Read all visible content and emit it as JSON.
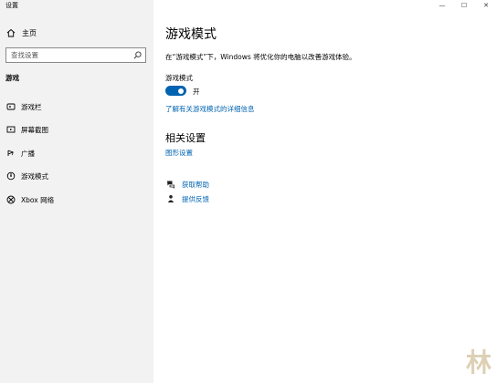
{
  "window": {
    "title": "设置",
    "controls": [
      "—",
      "☐",
      "✕"
    ]
  },
  "sidebar": {
    "home_label": "主页",
    "search_placeholder": "查找设置",
    "section_label": "游戏",
    "items": [
      {
        "label": "游戏栏",
        "icon": "game-bar-icon"
      },
      {
        "label": "屏幕截图",
        "icon": "capture-icon"
      },
      {
        "label": "广播",
        "icon": "broadcast-icon"
      },
      {
        "label": "游戏模式",
        "icon": "game-mode-icon"
      },
      {
        "label": "Xbox 网络",
        "icon": "xbox-icon"
      }
    ]
  },
  "main": {
    "title": "游戏模式",
    "description": "在“游戏模式”下，Windows 将优化你的电脑以改善游戏体验。",
    "toggle_label": "游戏模式",
    "toggle_state": "开",
    "toggle_on": true,
    "learn_more": "了解有关游戏模式的详细信息",
    "related_title": "相关设置",
    "graphics_link": "图形设置",
    "get_help": "获取帮助",
    "feedback": "提供反馈"
  },
  "watermark": "林",
  "colors": {
    "accent": "#0063b1",
    "sidebar_bg": "#f2f2f2"
  }
}
